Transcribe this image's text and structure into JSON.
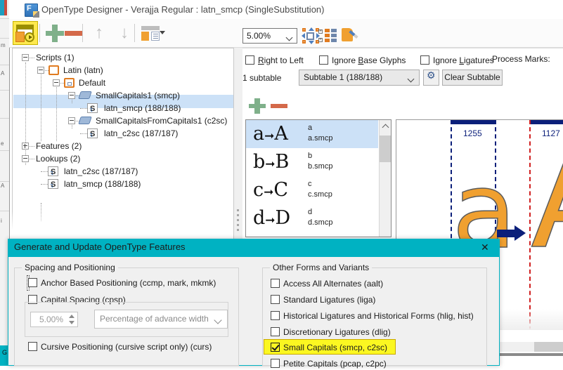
{
  "window": {
    "title": "OpenType Designer - Verajja Regular : latn_smcp (SingleSubstitution)",
    "app_icon": "font-designer-icon"
  },
  "toolbar": {
    "buttons": [
      {
        "name": "generate-features-button",
        "label": "Generate and Update OpenType Features",
        "icon": "generate-features-icon",
        "active": true
      },
      {
        "name": "add-button",
        "label": "Add",
        "icon": "plus-icon"
      },
      {
        "name": "remove-button",
        "label": "Remove",
        "icon": "minus-icon"
      },
      {
        "name": "move-up-button",
        "label": "Move Up",
        "icon": "arrow-up-icon"
      },
      {
        "name": "move-down-button",
        "label": "Move Down",
        "icon": "arrow-down-icon"
      },
      {
        "name": "view-mode-button",
        "label": "View Mode",
        "icon": "table-view-icon"
      }
    ]
  },
  "tree": {
    "nodes": [
      {
        "label": "Scripts (1)",
        "indent": 0,
        "expander": "minus",
        "icon": "none",
        "selected": false
      },
      {
        "label": "Latin (latn)",
        "indent": 1,
        "expander": "minus",
        "icon": "script-icon",
        "selected": false
      },
      {
        "label": "Default",
        "indent": 2,
        "expander": "minus",
        "icon": "language-icon",
        "selected": false
      },
      {
        "label": "SmallCapitals1 (smcp)",
        "indent": 3,
        "expander": "minus",
        "icon": "feature-icon",
        "selected": false
      },
      {
        "label": "latn_smcp (188/188)",
        "indent": 4,
        "expander": "none",
        "icon": "lookup-icon",
        "selected": true
      },
      {
        "label": "SmallCapitalsFromCapitals1 (c2sc)",
        "indent": 3,
        "expander": "minus",
        "icon": "feature-icon",
        "selected": false
      },
      {
        "label": "latn_c2sc (187/187)",
        "indent": 4,
        "expander": "none",
        "icon": "lookup-icon",
        "selected": false
      },
      {
        "label": "Features (2)",
        "indent": 0,
        "expander": "plus",
        "icon": "none",
        "selected": false
      },
      {
        "label": "Lookups (2)",
        "indent": 0,
        "expander": "minus",
        "icon": "none",
        "selected": false
      },
      {
        "label": "latn_c2sc (187/187)",
        "indent": 1,
        "expander": "none",
        "icon": "lookup-icon",
        "selected": false
      },
      {
        "label": "latn_smcp (188/188)",
        "indent": 1,
        "expander": "none",
        "icon": "lookup-icon",
        "selected": false
      }
    ]
  },
  "right_pane": {
    "zoom": {
      "value": "5.00%",
      "name": "zoom-combo"
    },
    "icon_buttons": [
      {
        "name": "fit-to-window-button",
        "icon": "fit-to-window-icon"
      },
      {
        "name": "glyph-grid-button",
        "icon": "glyph-grid-icon"
      },
      {
        "name": "edit-glyph-button",
        "icon": "edit-glyph-icon"
      }
    ],
    "options": [
      {
        "name": "right-to-left-checkbox",
        "label": "Right to Left",
        "accel": "R",
        "checked": false
      },
      {
        "name": "ignore-base-glyphs-checkbox",
        "label": "Ignore Base Glyphs",
        "accel": "B",
        "checked": false
      },
      {
        "name": "ignore-ligatures-checkbox",
        "label": "Ignore Ligatures",
        "accel": "L",
        "checked": false
      }
    ],
    "process_marks_label": "Process Marks:",
    "subtable_count_label": "1 subtable",
    "subtable_combo_value": "Subtable 1 (188/188)",
    "gear_button_label": "Subtable settings",
    "clear_subtable_button": "Clear Subtable",
    "list_toolbar": [
      {
        "name": "add-substitution-button",
        "icon": "plus-icon"
      },
      {
        "name": "remove-substitution-button",
        "icon": "minus-icon"
      }
    ],
    "substitutions": [
      {
        "from_glyph": "a",
        "to_glyph": "A",
        "from_name": "a",
        "to_name": "a.smcp",
        "selected": true
      },
      {
        "from_glyph": "b",
        "to_glyph": "B",
        "from_name": "b",
        "to_name": "b.smcp",
        "selected": false
      },
      {
        "from_glyph": "c",
        "to_glyph": "C",
        "from_name": "c",
        "to_name": "c.smcp",
        "selected": false
      },
      {
        "from_glyph": "d",
        "to_glyph": "D",
        "from_name": "d",
        "to_name": "d.smcp",
        "selected": false
      }
    ],
    "preview": {
      "source_advance_width": "1255",
      "target_advance_width": "1127",
      "source_glyph": "a",
      "target_glyph": "A",
      "arrow": "substitution-arrow-icon"
    }
  },
  "dialog": {
    "title": "Generate and Update OpenType Features",
    "close_label": "Close",
    "left_group": {
      "title": "Spacing and Positioning",
      "items": [
        {
          "name": "anchor-based-positioning-checkbox",
          "label": "Anchor Based Positioning (ccmp, mark, mkmk)",
          "checked": false,
          "focused": true
        },
        {
          "name": "capital-spacing-checkbox",
          "label": "Capital Spacing (cpsp)",
          "checked": false,
          "focused": false
        },
        {
          "name": "cursive-positioning-checkbox",
          "label": "Cursive Positioning (cursive script only) (curs)",
          "checked": false,
          "focused": false
        }
      ],
      "cpsp_value": "5.00%",
      "cpsp_unit": "Percentage of advance width"
    },
    "right_group": {
      "title": "Other Forms and Variants",
      "items": [
        {
          "name": "access-all-alternates-checkbox",
          "label": "Access All Alternates (aalt)",
          "checked": false,
          "highlighted": false
        },
        {
          "name": "standard-ligatures-checkbox",
          "label": "Standard Ligatures (liga)",
          "checked": false,
          "highlighted": false
        },
        {
          "name": "historical-ligatures-checkbox",
          "label": "Historical Ligatures and Historical Forms (hlig, hist)",
          "checked": false,
          "highlighted": false
        },
        {
          "name": "discretionary-ligatures-checkbox",
          "label": "Discretionary Ligatures (dlig)",
          "checked": false,
          "highlighted": false
        },
        {
          "name": "small-capitals-checkbox",
          "label": "Small Capitals (smcp, c2sc)",
          "checked": true,
          "highlighted": true
        },
        {
          "name": "petite-capitals-checkbox",
          "label": "Petite Capitals (pcap, c2pc)",
          "checked": false,
          "highlighted": false
        }
      ]
    }
  },
  "colors": {
    "accent_teal": "#00b2c2",
    "highlight_yellow": "#fbf721",
    "selection_blue": "#cce1f7",
    "glyph_orange": "#f0a030",
    "metric_navy": "#0b1f7a",
    "metric_red": "#d02020"
  }
}
